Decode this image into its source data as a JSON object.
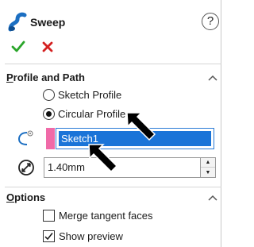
{
  "header": {
    "title": "Sweep",
    "help_label": "?"
  },
  "profile_and_path": {
    "title_underlined": "P",
    "title_rest": "rofile and Path",
    "sketch_profile_label": "Sketch Profile",
    "circular_profile_label": "Circular Profile",
    "selected_profile": "circular",
    "path_value": "Sketch1",
    "path_color": "#f06aa8",
    "diameter_value": "1.40mm"
  },
  "options": {
    "title_underlined": "O",
    "title_rest": "ptions",
    "merge_tangent_faces_label": "Merge tangent faces",
    "merge_tangent_faces_checked": false,
    "show_preview_label": "Show preview",
    "show_preview_checked": true
  },
  "colors": {
    "accent": "#1a74d8",
    "ok_green": "#2aa52a",
    "cancel_red": "#d42020"
  }
}
